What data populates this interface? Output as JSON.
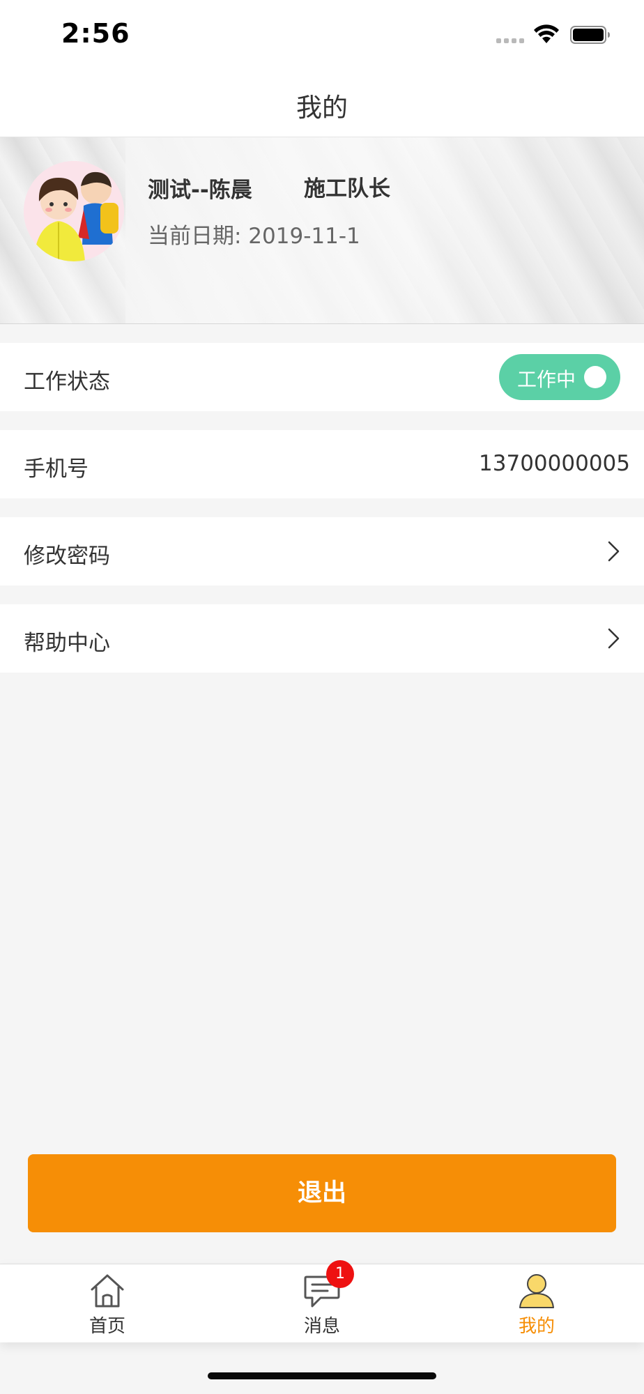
{
  "status_bar": {
    "time": "2:56"
  },
  "nav": {
    "title": "我的"
  },
  "profile": {
    "name": "测试--陈晨",
    "role": "施工队长",
    "date_text": "当前日期: 2019-11-1"
  },
  "rows": {
    "work_status": {
      "label": "工作状态",
      "toggle_label": "工作中",
      "toggle_on": true
    },
    "phone": {
      "label": "手机号",
      "value": "13700000005"
    },
    "change_password": {
      "label": "修改密码"
    },
    "help_center": {
      "label": "帮助中心"
    }
  },
  "logout": {
    "label": "退出"
  },
  "tab_bar": {
    "items": [
      {
        "label": "首页",
        "icon": "home-icon",
        "active": false
      },
      {
        "label": "消息",
        "icon": "message-icon",
        "active": false,
        "badge": "1"
      },
      {
        "label": "我的",
        "icon": "person-icon",
        "active": true
      }
    ]
  },
  "colors": {
    "accent": "#f68e06",
    "toggle_on": "#5bd0a6",
    "badge": "#ee1111",
    "page_bg": "#f5f5f5"
  }
}
